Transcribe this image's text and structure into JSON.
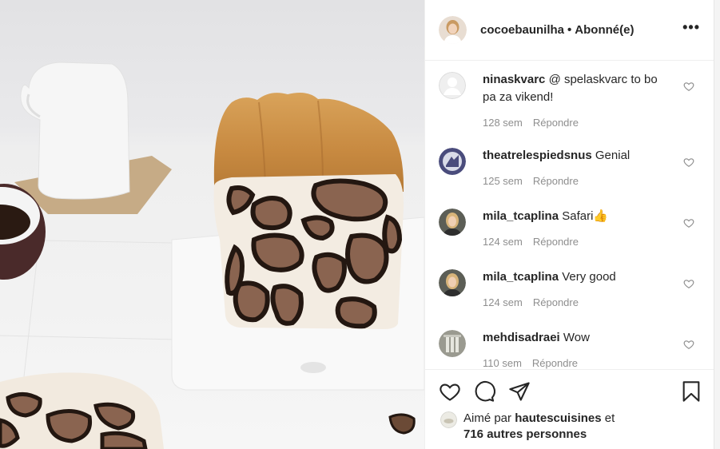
{
  "post": {
    "author": "cocoebaunilha",
    "separator": "•",
    "follow_state": "Abonné(e)",
    "more_icon": "more-horizontal-icon"
  },
  "comments": [
    {
      "user": "ninaskvarc",
      "text": "@ spelaskvarc to bo pa za vikend!",
      "age": "128 sem",
      "reply": "Répondre",
      "avatar": "default-avatar"
    },
    {
      "user": "theatrelespiedsnus",
      "text": "Genial",
      "age": "125 sem",
      "reply": "Répondre",
      "avatar": "theatre-logo-avatar"
    },
    {
      "user": "mila_tcaplina",
      "text": "Safari👍",
      "age": "124 sem",
      "reply": "Répondre",
      "avatar": "photo-avatar"
    },
    {
      "user": "mila_tcaplina",
      "text": "Very good",
      "age": "124 sem",
      "reply": "Répondre",
      "avatar": "photo-avatar"
    },
    {
      "user": "mehdisadraei",
      "text": "Wow",
      "age": "110 sem",
      "reply": "Répondre",
      "avatar": "photo-avatar"
    }
  ],
  "actions": {
    "like_icon": "heart-icon",
    "comment_icon": "comment-icon",
    "share_icon": "paper-plane-icon",
    "save_icon": "bookmark-icon"
  },
  "likes": {
    "prefix": "Aimé par",
    "user": "hautescuisines",
    "joiner": "et",
    "others": "716 autres personnes"
  },
  "colors": {
    "text": "#262626",
    "muted": "#8e8e8e",
    "divider": "#efefef",
    "crust": "#c8904a",
    "dough": "#f4ece0",
    "spot_dark": "#2a1d17",
    "spot_fill": "#8a6450"
  }
}
